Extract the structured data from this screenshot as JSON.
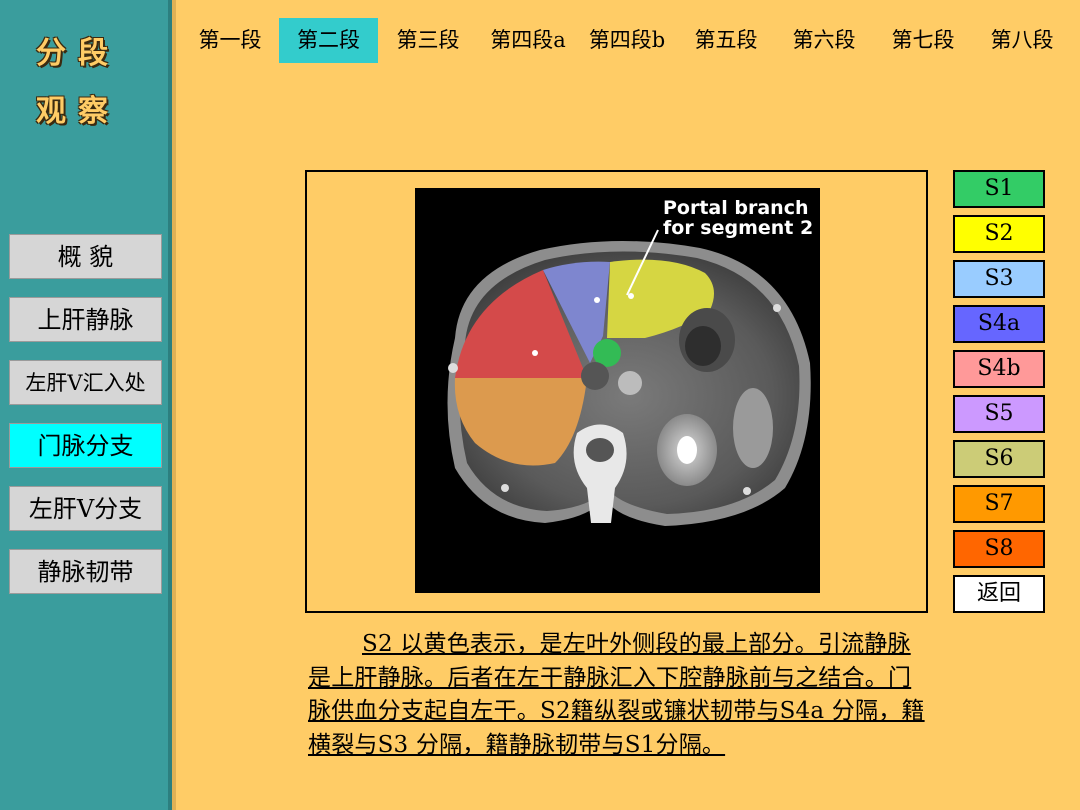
{
  "sidebar": {
    "logo_line1": "分段",
    "logo_line2": "观察",
    "items": [
      {
        "label": "概  貌"
      },
      {
        "label": "上肝静脉"
      },
      {
        "label": "左肝V汇入处"
      },
      {
        "label": "门脉分支",
        "active": true
      },
      {
        "label": "左肝V分支"
      },
      {
        "label": "静脉韧带"
      }
    ]
  },
  "top_nav": {
    "tabs": [
      {
        "label": "第一段"
      },
      {
        "label": "第二段",
        "active": true
      },
      {
        "label": "第三段"
      },
      {
        "label": "第四段a"
      },
      {
        "label": "第四段b"
      },
      {
        "label": "第五段"
      },
      {
        "label": "第六段"
      },
      {
        "label": "第七段"
      },
      {
        "label": "第八段"
      }
    ]
  },
  "image": {
    "annotation_line1": "Portal branch",
    "annotation_line2": "for segment 2"
  },
  "segments": [
    {
      "label": "S1",
      "color": "#33CC66"
    },
    {
      "label": "S2",
      "color": "#FFFF00"
    },
    {
      "label": "S3",
      "color": "#99CCFF"
    },
    {
      "label": "S4a",
      "color": "#6666FF"
    },
    {
      "label": "S4b",
      "color": "#FF9999"
    },
    {
      "label": "S5",
      "color": "#CC99FF"
    },
    {
      "label": "S6",
      "color": "#CCCC77"
    },
    {
      "label": "S7",
      "color": "#FF9900"
    },
    {
      "label": "S8",
      "color": "#FF6600"
    },
    {
      "label": "返回",
      "color": "#FFFFFF"
    }
  ],
  "description": "S2 以黄色表示，是左叶外侧段的最上部分。引流静脉是上肝静脉。后者在左干静脉汇入下腔静脉前与之结合。门脉供血分支起自左干。S2籍纵裂或镰状韧带与S4a 分隔，籍横裂与S3 分隔，籍静脉韧带与S1分隔。",
  "colors": {
    "background": "#FFCC66",
    "sidebar": "#3A9D9D",
    "active_tab": "#33CCCC",
    "active_sidebar": "#00FFFF"
  }
}
